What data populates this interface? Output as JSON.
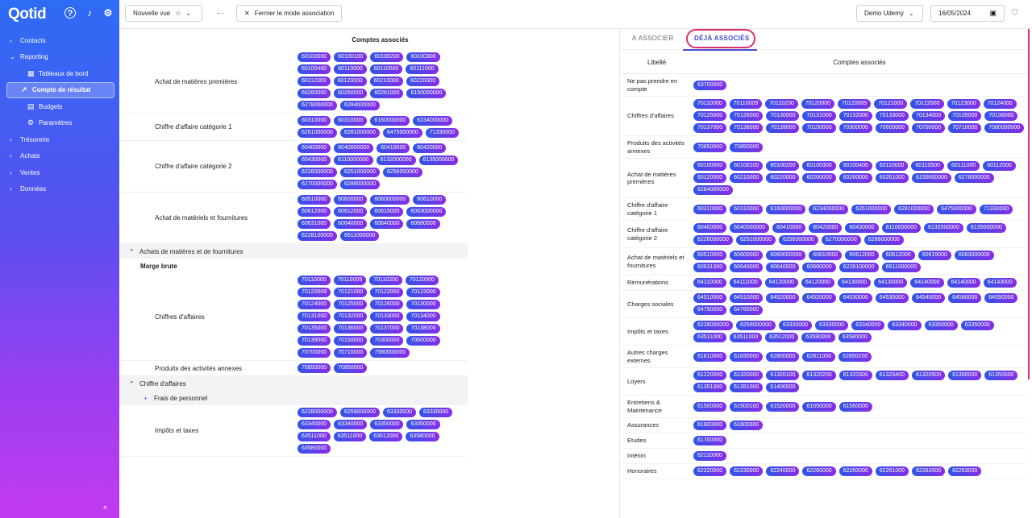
{
  "app": {
    "brand": "Qotid"
  },
  "sidebar": {
    "items": [
      {
        "label": "Contacts",
        "chev": "›"
      },
      {
        "label": "Reporting",
        "chev": "⌄",
        "children": [
          {
            "label": "Tableaux de bord",
            "icon": "dashboard-icon"
          },
          {
            "label": "Compte de résultat",
            "icon": "trend-icon",
            "active": true
          },
          {
            "label": "Budgets",
            "icon": "budget-icon"
          },
          {
            "label": "Paramètres",
            "icon": "gear-icon"
          }
        ]
      },
      {
        "label": "Trésorerie",
        "chev": "›"
      },
      {
        "label": "Achats",
        "chev": "›"
      },
      {
        "label": "Ventes",
        "chev": "›"
      },
      {
        "label": "Données",
        "chev": "›"
      }
    ],
    "collapse": "«"
  },
  "toolbar": {
    "view_label": "Nouvelle vue",
    "more": "···",
    "close_assoc": "Fermer le mode association",
    "company": "Demo Udemy",
    "date": "16/05/2024"
  },
  "left_panel": {
    "header": "Comptes associés",
    "rows": [
      {
        "type": "row",
        "label": "Achat de matières premières",
        "accounts": [
          "60100000",
          "60100100",
          "60100200",
          "60100300",
          "60100400",
          "60110000",
          "60110500",
          "60111000",
          "60112000",
          "60120000",
          "60210000",
          "60220000",
          "60260000",
          "60260000",
          "60261000",
          "6150000000",
          "6278000000",
          "6284000000"
        ]
      },
      {
        "type": "row",
        "label": "Chiffre d'affaire catégorie 1",
        "accounts": [
          "60310000",
          "60310000",
          "6160000000",
          "6234000000",
          "6261000000",
          "6281000000",
          "6475000000",
          "71330000"
        ]
      },
      {
        "type": "row",
        "label": "Chiffre d'affaire catégorie 2",
        "accounts": [
          "60400000",
          "6040000000",
          "60410000",
          "60420000",
          "60430000",
          "6110000000",
          "6132000000",
          "6135000000",
          "6226000000",
          "6251000000",
          "6256000000",
          "6270000000",
          "6288000000"
        ]
      },
      {
        "type": "row",
        "label": "Achat de matériels et fournitures",
        "accounts": [
          "60510000",
          "60600000",
          "6060000000",
          "60610000",
          "60612000",
          "60612000",
          "60615000",
          "6063000000",
          "60631000",
          "60640000",
          "60640000",
          "60680000",
          "6228100000",
          "6511000000"
        ]
      },
      {
        "type": "section",
        "label": "Achats de matières et de fournitures",
        "symbol": "⌃"
      },
      {
        "type": "plain",
        "label": "Marge brute"
      },
      {
        "type": "row",
        "label": "Chiffres d'affaires",
        "accounts": [
          "70110000",
          "70110009",
          "70110200",
          "70120000",
          "70120009",
          "70121000",
          "70122000",
          "70123000",
          "70124000",
          "70125000",
          "70126000",
          "70130000",
          "70131000",
          "70132000",
          "70133000",
          "70134000",
          "70135000",
          "70136000",
          "70137000",
          "70138000",
          "70139000",
          "70150000",
          "70300000",
          "70600000",
          "70700000",
          "70710000",
          "7580000000"
        ]
      },
      {
        "type": "row",
        "label": "Produits des activités annexes",
        "accounts": [
          "70850000",
          "70850000"
        ]
      },
      {
        "type": "section",
        "label": "Chiffre d'affaires",
        "symbol": "⌃"
      },
      {
        "type": "section2",
        "label": "Frais de personnel",
        "symbol": "+"
      },
      {
        "type": "row",
        "label": "Impôts et taxes",
        "accounts": [
          "6228000000",
          "6259000000",
          "63330000",
          "63330000",
          "63340000",
          "63340000",
          "63350000",
          "63350000",
          "63511000",
          "63511000",
          "63512000",
          "63580000",
          "63580000"
        ]
      }
    ]
  },
  "right_panel": {
    "tab_to_associate": "À ASSOCIER",
    "tab_associated": "DÉJÀ ASSOCIÉS",
    "col_label": "Libellé",
    "col_accounts": "Comptes associés",
    "rows": [
      {
        "label": "Ne pas prendre en compte",
        "accounts": [
          "63700000"
        ]
      },
      {
        "label": "Chiffres d'affaires",
        "accounts": [
          "70110000",
          "70110009",
          "70110200",
          "70120000",
          "70120009",
          "70121000",
          "70122000",
          "70123000",
          "70124000",
          "70125000",
          "70126000",
          "70130000",
          "70131000",
          "70132000",
          "70133000",
          "70134000",
          "70135000",
          "70136000",
          "70137000",
          "70138000",
          "70139000",
          "70150000",
          "70300000",
          "70600000",
          "70700000",
          "70710000",
          "7580000000"
        ]
      },
      {
        "label": "Produits des activités annexes",
        "accounts": [
          "70850000",
          "70850000"
        ]
      },
      {
        "label": "Achat de matières premières",
        "accounts": [
          "60100000",
          "60100100",
          "60100200",
          "60100300",
          "60100400",
          "60110000",
          "60110500",
          "60111000",
          "60112000",
          "60120000",
          "60210000",
          "60220000",
          "60260000",
          "60260000",
          "60261000",
          "6150000000",
          "6278000000",
          "6284000000"
        ]
      },
      {
        "label": "Chiffre d'affaire catégorie 1",
        "accounts": [
          "60310000",
          "60310000",
          "6160000000",
          "6234000000",
          "6261000000",
          "6281000000",
          "6475000000",
          "71330000"
        ]
      },
      {
        "label": "Chiffre d'affaire catégorie 2",
        "accounts": [
          "60400000",
          "6040000000",
          "60410000",
          "60420000",
          "60430000",
          "6110000000",
          "6132000000",
          "6135000000",
          "6226000000",
          "6251000000",
          "6256000000",
          "6270000000",
          "6288000000"
        ]
      },
      {
        "label": "Achat de matériels et fournitures",
        "accounts": [
          "60510000",
          "60600000",
          "6060000000",
          "60610000",
          "60612000",
          "60612000",
          "60615000",
          "6063000000",
          "60631000",
          "60640000",
          "60640000",
          "60680000",
          "6228100000",
          "6511000000"
        ]
      },
      {
        "label": "Rémunérations",
        "accounts": [
          "64110000",
          "64111000",
          "64120000",
          "64120000",
          "64130000",
          "64130000",
          "64140000",
          "64140000",
          "64143000"
        ]
      },
      {
        "label": "Charges sociales",
        "accounts": [
          "64510000",
          "64510000",
          "64520000",
          "64520000",
          "64530000",
          "64530000",
          "64540000",
          "64580000",
          "64590000",
          "64750000",
          "64760000"
        ]
      },
      {
        "label": "Impôts et taxes",
        "accounts": [
          "6228000000",
          "6259000000",
          "63330000",
          "63330000",
          "63340000",
          "63340000",
          "63350000",
          "63350000",
          "63511000",
          "63511000",
          "63512000",
          "63580000",
          "63580000"
        ]
      },
      {
        "label": "Autres charges externes",
        "accounts": [
          "61810000",
          "61830000",
          "62800000",
          "62811000",
          "62850200"
        ]
      },
      {
        "label": "Loyers",
        "accounts": [
          "61220000",
          "61320000",
          "61320100",
          "61320200",
          "61320300",
          "61320400",
          "61320500",
          "61350000",
          "61350000",
          "61351000",
          "61351000",
          "61400000"
        ]
      },
      {
        "label": "Entretiens & Maintenance",
        "accounts": [
          "61500000",
          "61500100",
          "61520000",
          "61550000",
          "61560000"
        ]
      },
      {
        "label": "Assurances",
        "accounts": [
          "61600000",
          "61600000"
        ]
      },
      {
        "label": "Etudes",
        "accounts": [
          "61700000"
        ]
      },
      {
        "label": "Intérim",
        "accounts": [
          "62110000"
        ]
      },
      {
        "label": "Honoraires",
        "accounts": [
          "62220000",
          "62230000",
          "62240000",
          "62260000",
          "62260000",
          "62261000",
          "62262000",
          "62263000"
        ]
      }
    ]
  }
}
